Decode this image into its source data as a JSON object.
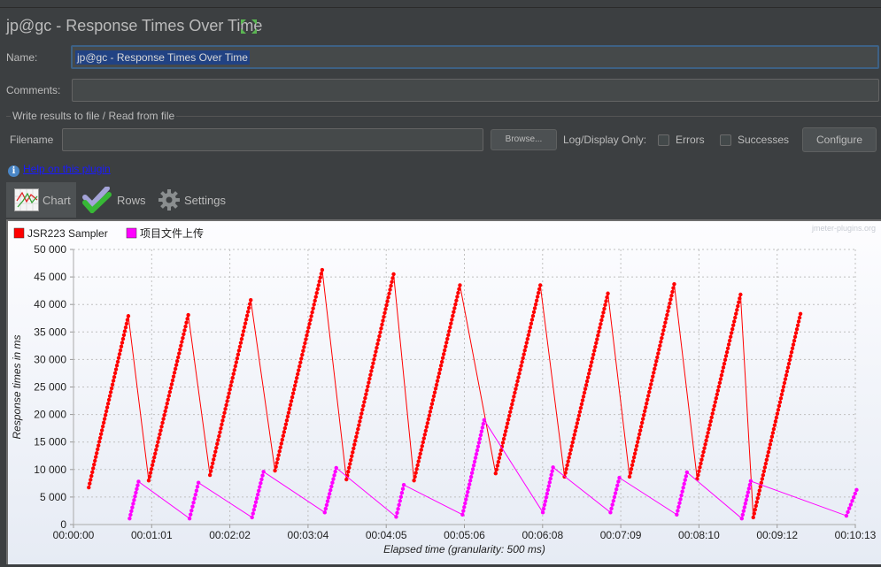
{
  "header": {
    "title": "jp@gc - Response Times Over Time"
  },
  "form": {
    "name_label": "Name:",
    "name_value": "jp@gc - Response Times Over Time",
    "comments_label": "Comments:",
    "comments_value": "",
    "group_title": "Write results to file / Read from file",
    "filename_label": "Filename",
    "filename_value": "",
    "browse_label": "Browse...",
    "log_display_label": "Log/Display Only:",
    "errors_label": "Errors",
    "errors_checked": false,
    "successes_label": "Successes",
    "successes_checked": false,
    "configure_label": "Configure",
    "help_link": "Help on this plugin"
  },
  "tabs": [
    {
      "label": "Chart",
      "icon": "chart-icon",
      "active": true
    },
    {
      "label": "Rows",
      "icon": "checkmark-icon",
      "active": false
    },
    {
      "label": "Settings",
      "icon": "gear-icon",
      "active": false
    }
  ],
  "watermark": "jmeter-plugins.org",
  "chart_data": {
    "type": "line",
    "title": "",
    "xlabel": "Elapsed time (granularity: 500 ms)",
    "ylabel": "Response times in ms",
    "xlim_seconds": [
      0,
      613
    ],
    "ylim": [
      0,
      50000
    ],
    "x_tick_labels": [
      "00:00:00",
      "00:01:01",
      "00:02:02",
      "00:03:04",
      "00:04:05",
      "00:05:06",
      "00:06:08",
      "00:07:09",
      "00:08:10",
      "00:09:12",
      "00:10:13"
    ],
    "y_tick_labels": [
      "0",
      "5 000",
      "10 000",
      "15 000",
      "20 000",
      "25 000",
      "30 000",
      "35 000",
      "40 000",
      "45 000",
      "50 000"
    ],
    "y_ticks": [
      0,
      5000,
      10000,
      15000,
      20000,
      25000,
      30000,
      35000,
      40000,
      45000,
      50000
    ],
    "grid": true,
    "legend_position": "top-left",
    "series": [
      {
        "name": "JSR223 Sampler",
        "color": "#ff0000",
        "points": [
          [
            12,
            6750
          ],
          [
            43,
            37900
          ],
          [
            59,
            8000
          ],
          [
            90,
            38100
          ],
          [
            107,
            9000
          ],
          [
            139,
            40800
          ],
          [
            158,
            9800
          ],
          [
            195,
            46300
          ],
          [
            214,
            8200
          ],
          [
            251,
            45500
          ],
          [
            267,
            8000
          ],
          [
            303,
            43500
          ],
          [
            331,
            9300
          ],
          [
            366,
            43500
          ],
          [
            385,
            8700
          ],
          [
            419,
            42000
          ],
          [
            436,
            8700
          ],
          [
            471,
            43700
          ],
          [
            489,
            8300
          ],
          [
            523,
            41800
          ],
          [
            533,
            1300
          ],
          [
            570,
            38300
          ]
        ]
      },
      {
        "name": "项目文件上传",
        "color": "#ff00ff",
        "points": [
          [
            44,
            1100
          ],
          [
            51,
            7800
          ],
          [
            91,
            1100
          ],
          [
            98,
            7600
          ],
          [
            140,
            1300
          ],
          [
            149,
            9600
          ],
          [
            197,
            2200
          ],
          [
            206,
            10300
          ],
          [
            253,
            1400
          ],
          [
            259,
            7200
          ],
          [
            305,
            1800
          ],
          [
            322,
            19000
          ],
          [
            368,
            2200
          ],
          [
            376,
            10400
          ],
          [
            421,
            2200
          ],
          [
            428,
            8500
          ],
          [
            473,
            1800
          ],
          [
            481,
            9500
          ],
          [
            524,
            1100
          ],
          [
            531,
            7900
          ],
          [
            606,
            1600
          ],
          [
            614,
            6300
          ]
        ]
      }
    ]
  }
}
